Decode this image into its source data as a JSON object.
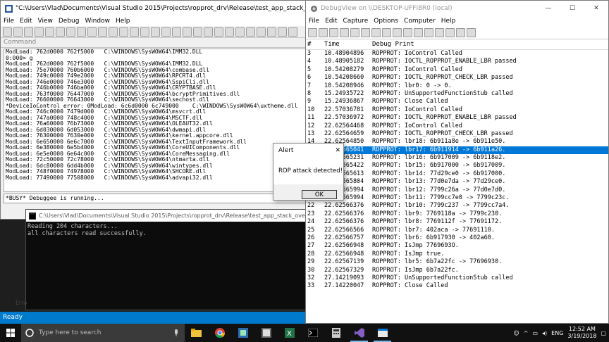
{
  "windbg": {
    "title": "\"C:\\Users\\Vlad\\Documents\\Visual Studio 2015\\Projects\\ropprot_drv\\Release\\test_app_stack_overflow.exe\" - WinDbg",
    "menu": [
      "File",
      "Edit",
      "View",
      "Debug",
      "Window",
      "Help"
    ],
    "command_header": "Command",
    "lines": [
      "ModLoad: 762d0000 762f5000   C:\\WINDOWS\\SysWOW64\\IMM32.DLL",
      "0:000> g",
      "ModLoad: 762d0000 762f5000   C:\\WINDOWS\\SysWOW64\\IMM32.DLL",
      "ModLoad: 75e70000 760b6000   C:\\WINDOWS\\SysWOW64\\combase.dll",
      "ModLoad: 749c0000 749e2000   C:\\WINDOWS\\SysWOW64\\RPCRT4.dll",
      "ModLoad: 746e0000 746e3000   C:\\WINDOWS\\SysWOW64\\SspiCli.dll",
      "ModLoad: 746b0000 746ba000   C:\\WINDOWS\\SysWOW64\\CRYPTBASE.dll",
      "ModLoad: 763f0000 76447000   C:\\WINDOWS\\SysWOW64\\bcryptPrimitives.dll",
      "ModLoad: 76600000 76643000   C:\\WINDOWS\\SysWOW64\\sechost.dll",
      "*DeviceIoControl error: 0ModLoad: 6c6d0000 6c749000    C:\\WINDOWS\\SysWOW64\\uxtheme.dll",
      "ModLoad: 746c0000 7479d000   C:\\WINDOWS\\SysWOW64\\msvcrt.dll",
      "ModLoad: 747a0000 748c4000   C:\\WINDOWS\\SysWOW64\\MSCTF.dll",
      "ModLoad: 76a60000 76b73000   C:\\WINDOWS\\SysWOW64\\OLEAUT32.dll",
      "ModLoad: 6d030000 6d053000   C:\\WINDOWS\\SysWOW64\\dwmapi.dll",
      "ModLoad: 76300000 7630e000   C:\\WINDOWS\\SysWOW64\\kernel.appcore.dll",
      "ModLoad: 6e650000 6e6c7000   C:\\WINDOWS\\SysWOW64\\TextInputFramework.dll",
      "ModLoad: 6e380000 6e5b4000   C:\\WINDOWS\\SysWOW64\\CoreUIComponents.dll",
      "ModLoad: 6e5e0000 6e64c000   C:\\WINDOWS\\SysWOW64\\CoreMessaging.dll",
      "ModLoad: 72c50000 72c78000   C:\\WINDOWS\\SysWOW64\\ntmarta.dll",
      "ModLoad: 6dc80000 6dd4b000   C:\\WINDOWS\\SysWOW64\\wintypes.dll",
      "ModLoad: 748f0000 74978000   C:\\WINDOWS\\SysWOW64\\SHCORE.dll",
      "ModLoad: 77490000 77508000   C:\\WINDOWS\\SysWOW64\\advapi32.dll"
    ],
    "status": "*BUSY* Debuggee is running..."
  },
  "console": {
    "title": "C:\\Users\\Vlad\\Documents\\Visual Studio 2015\\Projects\\ropprot_drv\\Release\\test_app_stack_overflow.exe",
    "lines": [
      "Reading 204 characters...",
      "all characters read successfully."
    ]
  },
  "statusbar": {
    "text": "Ready",
    "side_label": "Erro"
  },
  "debugview": {
    "title": "DebugView on \\\\DESKTOP-UFFI8R0 (local)",
    "menu": [
      "File",
      "Edit",
      "Capture",
      "Options",
      "Computer",
      "Help"
    ],
    "columns": [
      "#",
      "Time",
      "Debug Print"
    ],
    "rows": [
      {
        "n": "3",
        "t": "10.48904896",
        "m": "ROPPROT: IoControl Called"
      },
      {
        "n": "4",
        "t": "10.48905182",
        "m": "ROPPROT: IOCTL_ROPPROT_ENABLE_LBR passed"
      },
      {
        "n": "5",
        "t": "10.54208279",
        "m": "ROPPROT: IoControl Called"
      },
      {
        "n": "6",
        "t": "10.54208660",
        "m": "ROPPROT: IOCTL_ROPPROT_CHECK_LBR passed"
      },
      {
        "n": "7",
        "t": "10.54208946",
        "m": "ROPPROT: lbr0: 0 -> 0."
      },
      {
        "n": "8",
        "t": "15.24935722",
        "m": "ROPPROT: UnSupportedFunctionStub called"
      },
      {
        "n": "9",
        "t": "15.24936867",
        "m": "ROPPROT: Close Called"
      },
      {
        "n": "10",
        "t": "22.57036781",
        "m": "ROPPROT: IoControl Called"
      },
      {
        "n": "11",
        "t": "22.57036972",
        "m": "ROPPROT: IOCTL_ROPPROT_ENABLE_LBR passed"
      },
      {
        "n": "12",
        "t": "22.62564468",
        "m": "ROPPROT: IoControl Called"
      },
      {
        "n": "13",
        "t": "22.62564659",
        "m": "ROPPROT: IOCTL_ROPPROT_CHECK_LBR passed"
      },
      {
        "n": "14",
        "t": "22.62564850",
        "m": "ROPPROT: lbr18: 6b911a8e -> 6b911e50."
      },
      {
        "n": "15",
        "t": "22.62565041",
        "m": "ROPPROT: lbr17: 6b911914 -> 6b911a26."
      },
      {
        "n": "16",
        "t": "22.62565231",
        "m": "ROPPROT: lbr16: 6b917009 -> 6b9118e2."
      },
      {
        "n": "17",
        "t": "22.62565422",
        "m": "ROPPROT: lbr15: 6b917000 -> 6b917009."
      },
      {
        "n": "18",
        "t": "22.62565613",
        "m": "ROPPROT: lbr14: 77d29ce0 -> 6b917000."
      },
      {
        "n": "19",
        "t": "22.62565804",
        "m": "ROPPROT: lbr13: 77d0e7da -> 77d29ce0."
      },
      {
        "n": "20",
        "t": "22.62565994",
        "m": "ROPPROT: lbr12: 7799c26a -> 77d0e7d0."
      },
      {
        "n": "21",
        "t": "22.62565994",
        "m": "ROPPROT: lbr11: 7799cc7e0 -> 7799c23c."
      },
      {
        "n": "22",
        "t": "22.62566376",
        "m": "ROPPROT: lbr10: 7799c237 -> 7799cc7a4."
      },
      {
        "n": "23",
        "t": "22.62566376",
        "m": "ROPPROT: lbr9: 7769118a -> 7799c230."
      },
      {
        "n": "24",
        "t": "22.62566376",
        "m": "ROPPROT: lbr8: 7769112f -> 77691172."
      },
      {
        "n": "25",
        "t": "22.62566566",
        "m": "ROPPROT: lbr7: 402aca -> 77691110."
      },
      {
        "n": "26",
        "t": "22.62566757",
        "m": "ROPPROT: lbr6: 6b917930 -> 402a60."
      },
      {
        "n": "27",
        "t": "22.62566948",
        "m": "ROPPROT: IsJmp 7769693O."
      },
      {
        "n": "28",
        "t": "22.62566948",
        "m": "ROPPROT: IsJmp true."
      },
      {
        "n": "29",
        "t": "22.62567139",
        "m": "ROPPROT: lbr5: 6b7a22fc -> 77696930."
      },
      {
        "n": "30",
        "t": "22.62567329",
        "m": "ROPPROT: IsJmp 6b7a22fc."
      },
      {
        "n": "32",
        "t": "27.14219093",
        "m": "ROPPROT: UnSupportedFunctionStub called"
      },
      {
        "n": "33",
        "t": "27.14220047",
        "m": "ROPPROT: Close Called"
      }
    ],
    "selected_row": 12
  },
  "alert": {
    "title": "Alert",
    "message": "ROP attack detected!",
    "ok_label": "OK"
  },
  "taskbar": {
    "search_placeholder": "Type here to search",
    "time": "12:52 AM",
    "date": "3/19/2018",
    "lang": "ENG"
  },
  "colors": {
    "accent": "#0078d7",
    "statusbar": "#007acc",
    "taskbar": "#111111"
  }
}
